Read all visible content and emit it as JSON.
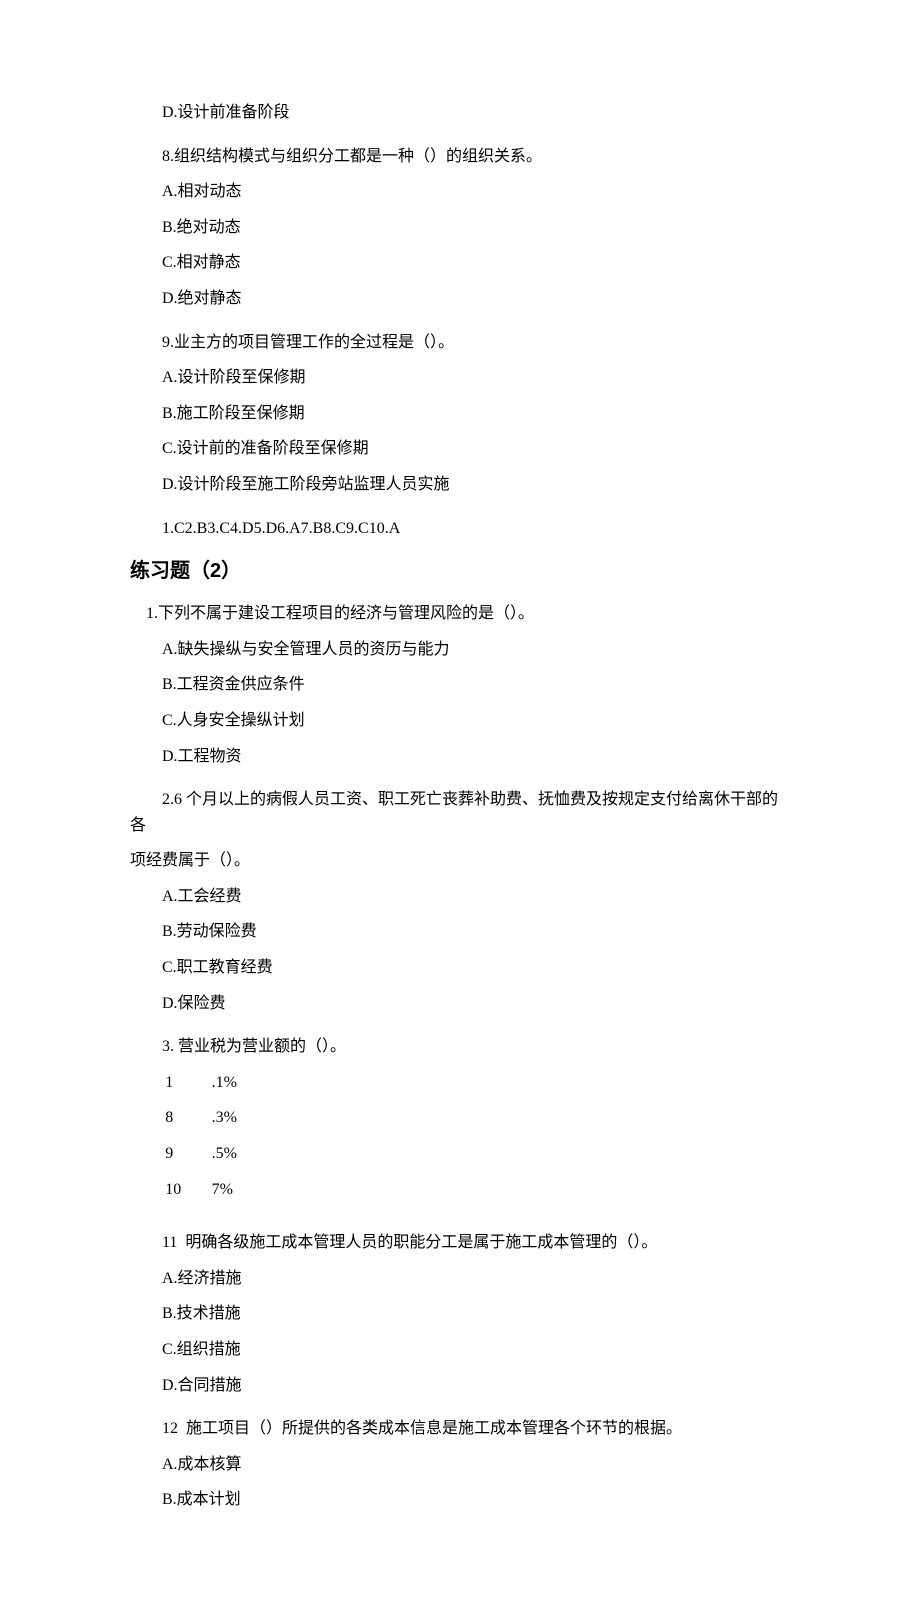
{
  "section1": {
    "q7d": "D.设计前准备阶段",
    "q8": {
      "stem": "8.组织结构模式与组织分工都是一种（）的组织关系。",
      "a": "A.相对动态",
      "b": "B.绝对动态",
      "c": "C.相对静态",
      "d": "D.绝对静态"
    },
    "q9": {
      "stem": "9.业主方的项目管理工作的全过程是（）。",
      "a": "A.设计阶段至保修期",
      "b": "B.施工阶段至保修期",
      "c": "C.设计前的准备阶段至保修期",
      "d": "D.设计阶段至施工阶段旁站监理人员实施"
    },
    "answers": "1.C2.B3.C4.D5.D6.A7.B8.C9.C10.A"
  },
  "heading2": "练习题（2）",
  "section2": {
    "q1": {
      "stem": "1.下列不属于建设工程项目的经济与管理风险的是（）。",
      "a": "A.缺失操纵与安全管理人员的资历与能力",
      "b": "B.工程资金供应条件",
      "c": "C.人身安全操纵计划",
      "d": "D.工程物资"
    },
    "q2": {
      "stem_l1": "2.6 个月以上的病假人员工资、职工死亡丧葬补助费、抚恤费及按规定支付给离休干部的各",
      "stem_l2": "项经费属于（）。",
      "a": "A.工会经费",
      "b": "B.劳动保险费",
      "c": "C.职工教育经费",
      "d": "D.保险费"
    },
    "q3": {
      "stem": "3. 营业税为营业额的（）。",
      "r1n": "1",
      "r1v": ".1%",
      "r2n": "8",
      "r2v": ".3%",
      "r3n": "9",
      "r3v": ".5%",
      "r4n": "10",
      "r4v": "7%"
    },
    "q4": {
      "num": "11",
      "stem": "明确各级施工成本管理人员的职能分工是属于施工成本管理的（）。",
      "a": "A.经济措施",
      "b": "B.技术措施",
      "c": "C.组织措施",
      "d": "D.合同措施"
    },
    "q5": {
      "num": "12",
      "stem": "施工项目（）所提供的各类成本信息是施工成本管理各个环节的根据。",
      "a": "A.成本核算",
      "b": "B.成本计划"
    }
  }
}
